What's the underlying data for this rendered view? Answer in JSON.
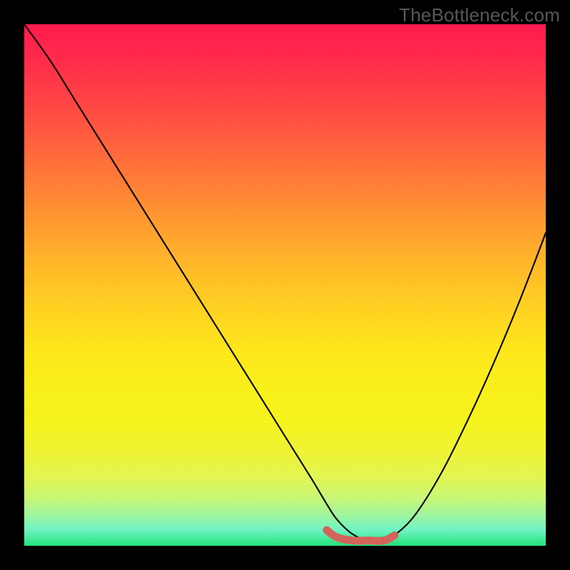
{
  "watermark": "TheBottleneck.com",
  "colors": {
    "curve": "#000000",
    "highlight": "#d4645b",
    "gradient_top": "#ff1a4f",
    "gradient_bottom": "#22e27a",
    "frame": "#000000"
  },
  "chart_data": {
    "type": "line",
    "title": "",
    "xlabel": "",
    "ylabel": "",
    "xlim": [
      0,
      100
    ],
    "ylim": [
      0,
      100
    ],
    "grid": false,
    "legend": false,
    "series": [
      {
        "name": "bottleneck_curve",
        "x": [
          0,
          5,
          10,
          15,
          20,
          25,
          30,
          35,
          40,
          45,
          50,
          55,
          58,
          60,
          63,
          66,
          69,
          71,
          75,
          80,
          85,
          90,
          95,
          100
        ],
        "y": [
          100,
          93,
          85,
          77,
          69,
          61,
          53,
          45,
          37,
          29,
          21,
          13,
          8,
          5,
          2.2,
          1.0,
          1.0,
          2.0,
          6,
          14,
          24,
          35,
          47,
          60
        ]
      }
    ],
    "optimal_range": {
      "x": [
        58,
        60,
        63,
        66,
        69,
        71
      ],
      "y": [
        3.0,
        1.6,
        1.0,
        1.0,
        1.0,
        2.0
      ]
    }
  }
}
